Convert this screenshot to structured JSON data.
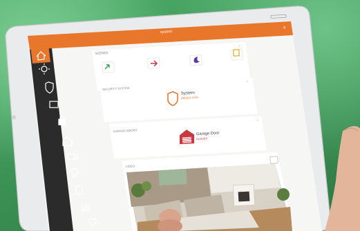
{
  "app": {
    "title": "system",
    "accent_color": "#e8772b",
    "sidebar_color": "#2b2b2b"
  },
  "sidebar": {
    "items": [
      {
        "icon": "home-icon"
      },
      {
        "icon": "sun-icon"
      },
      {
        "icon": "shield-icon"
      },
      {
        "icon": "image-icon"
      },
      {
        "icon": "lock-icon"
      },
      {
        "icon": "garage-icon"
      },
      {
        "icon": "video-icon"
      },
      {
        "icon": "bulb-icon"
      },
      {
        "icon": "thermostat-icon"
      },
      {
        "icon": "chart-icon"
      },
      {
        "icon": "heart-icon"
      }
    ]
  },
  "scenes": {
    "label": "SCENES",
    "items": [
      {
        "icon": "arrive-icon",
        "color": "#3da05a"
      },
      {
        "icon": "leave-icon",
        "color": "#c8383e"
      },
      {
        "icon": "moon-icon",
        "color": "#5b3aa8"
      },
      {
        "icon": "custom-scene-icon",
        "color": "#e0b32e"
      }
    ]
  },
  "security": {
    "label": "SECURITY SYSTEM",
    "status_title": "System",
    "status_sub": "ARMED STAY",
    "icon": "shield-icon"
  },
  "garage": {
    "label": "GARAGE DOORS",
    "status_title": "Garage Door",
    "status_sub": "CLOSED",
    "icon": "garage-icon"
  },
  "video": {
    "label": "VIDEO"
  }
}
